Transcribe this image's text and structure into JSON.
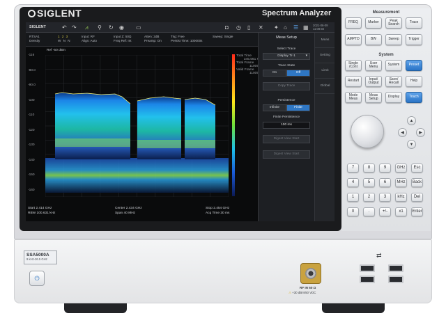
{
  "device": {
    "brand": "SIGLENT",
    "title": "Spectrum Analyzer",
    "model": "SSA5000A",
    "model_range": "9 kHz-26.5 GHz"
  },
  "toolbar": {
    "brand": "SIGLENT",
    "datetime": "2021-06-09\n11:08:56"
  },
  "infobar": {
    "mode_line1": "RTSA1",
    "mode_line2": "Density",
    "trace_nums": "1  2  3",
    "trace_types": "W  N  N",
    "input_line1": "Input: RF",
    "input_line2": "Align: Auto",
    "input2_line1": "Input Z: 50Ω",
    "input2_line2": "Freq Ref: Int",
    "atten_line1": "Atten: 2dB",
    "atten_line2": "Preamp: On",
    "trig_line1": "Trig: Free",
    "trig_line2": "Persist Time: 100000s",
    "sweep": "Sweep: Single"
  },
  "plot": {
    "ref": "Ref  -50 dBm",
    "y_ticks": [
      "-116",
      "-80.0",
      "-90.0",
      "-100",
      "-110",
      "-120",
      "-130",
      "-140",
      "-150",
      "-160"
    ],
    "stats": [
      {
        "label": "Total Time",
        "value": "345.561 s"
      },
      {
        "label": "Total Frame",
        "value": "11005"
      },
      {
        "label": "Valid Frame",
        "value": "11005"
      }
    ],
    "start": "Start  2.414 GHz",
    "rbw": "RBW  100.631 kHz",
    "center": "Center  2.434 GHz",
    "span": "Span  40 MHz",
    "stop": "Stop  2.454 GHz",
    "acq_time": "Acq Time  30 ms"
  },
  "meas_panel": {
    "title": "Meas Setup",
    "select_trace_label": "Select Trace",
    "select_trace_value": "Display Tr-1",
    "trace_state_label": "Trace State",
    "on": "On",
    "off": "Off",
    "copy_trace": "Copy Trace",
    "persistence_label": "Persistence",
    "infinite": "Infinite",
    "finite": "Finite",
    "finite_persistence_label": "Finite Persistence",
    "finite_persistence_value": "100 ms",
    "digest_1": "Digest View Start",
    "digest_2": "Digest View Start",
    "tabs": [
      "Meas",
      "Setting",
      "Limit",
      "Global"
    ]
  },
  "keypad": {
    "measurement_label": "Measurement",
    "meas_keys": [
      "FREQ",
      "Marker",
      "Peak\nSearch",
      "Trace",
      "AMPTD",
      "BW",
      "Sweep",
      "Trigger"
    ],
    "system_label": "System",
    "sys_keys": [
      "Single\n/Cont",
      "User\nMenu",
      "System",
      "Preset",
      "Restart",
      "Input/\nOutput",
      "Save/\nRecall",
      "Help",
      "Mode\nMeas",
      "Meas\nSetup",
      "Display",
      "Touch"
    ],
    "num_keys": [
      "7",
      "8",
      "9",
      "GHz",
      "Esc",
      "4",
      "5",
      "6",
      "MHz",
      "Back",
      "1",
      "2",
      "3",
      "kHz",
      "Del",
      "0",
      ".",
      "+/-",
      "x1",
      "Enter"
    ]
  },
  "front": {
    "rf_label": "RF IN 50 Ω",
    "rf_warning": "+30 dBm/50 VDC"
  },
  "colors": {
    "accent": "#2f77c4",
    "screen_bg": "#0a0b0c",
    "chassis": "#e4e5e8"
  }
}
